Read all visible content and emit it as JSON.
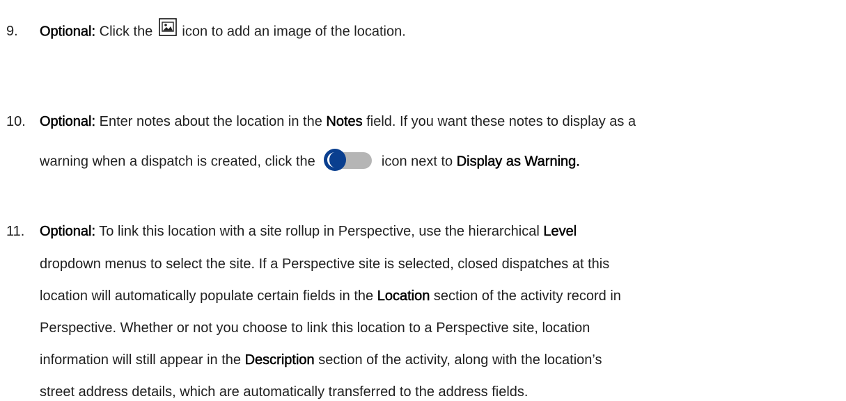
{
  "steps": [
    {
      "number": "9.",
      "lines": [
        {
          "segments": [
            {
              "text": "Optional:",
              "bold": true
            },
            {
              "text": " Click the ",
              "bold": false
            },
            {
              "icon": "image-icon"
            },
            {
              "text": " icon to add an image of the location.",
              "bold": false
            }
          ]
        }
      ]
    },
    {
      "number": "10.",
      "lines": [
        {
          "segments": [
            {
              "text": "Optional:",
              "bold": true
            },
            {
              "text": " Enter notes about the location in the ",
              "bold": false
            },
            {
              "text": "Notes",
              "bold": true
            },
            {
              "text": " field. If you want these notes to display as a",
              "bold": false
            }
          ]
        },
        {
          "segments": [
            {
              "text": "warning when a dispatch is created, click the ",
              "bold": false
            },
            {
              "icon": "toggle-switch-icon"
            },
            {
              "text": " icon next to ",
              "bold": false
            },
            {
              "text": "Display as Warning.",
              "bold": true
            }
          ]
        }
      ]
    },
    {
      "number": "11.",
      "lines": [
        {
          "segments": [
            {
              "text": "Optional:",
              "bold": true
            },
            {
              "text": " To link this location with a site rollup in Perspective, use the hierarchical ",
              "bold": false
            },
            {
              "text": "Level",
              "bold": true
            }
          ]
        },
        {
          "segments": [
            {
              "text": "dropdown menus to select the site. If a Perspective site is selected, closed dispatches at this",
              "bold": false
            }
          ]
        },
        {
          "segments": [
            {
              "text": "location will automatically populate certain fields in the ",
              "bold": false
            },
            {
              "text": "Location",
              "bold": true
            },
            {
              "text": " section of the activity record in",
              "bold": false
            }
          ]
        },
        {
          "segments": [
            {
              "text": "Perspective. Whether or not you choose to link this location to a Perspective site, location",
              "bold": false
            }
          ]
        },
        {
          "segments": [
            {
              "text": "information will still appear in the ",
              "bold": false
            },
            {
              "text": "Description",
              "bold": true
            },
            {
              "text": " section of the activity, along with the location’s",
              "bold": false
            }
          ]
        },
        {
          "segments": [
            {
              "text": "street address details, which are automatically transferred to the address fields.",
              "bold": false
            }
          ]
        }
      ]
    }
  ],
  "icons": {
    "image_icon_colors": {
      "border": "#111111",
      "fill": "#ffffff",
      "picture": "#222222"
    },
    "toggle_icon_colors": {
      "track": "#b5b5b5",
      "knob": "#0a3f8f",
      "knob_highlight": "#ffffff"
    }
  }
}
